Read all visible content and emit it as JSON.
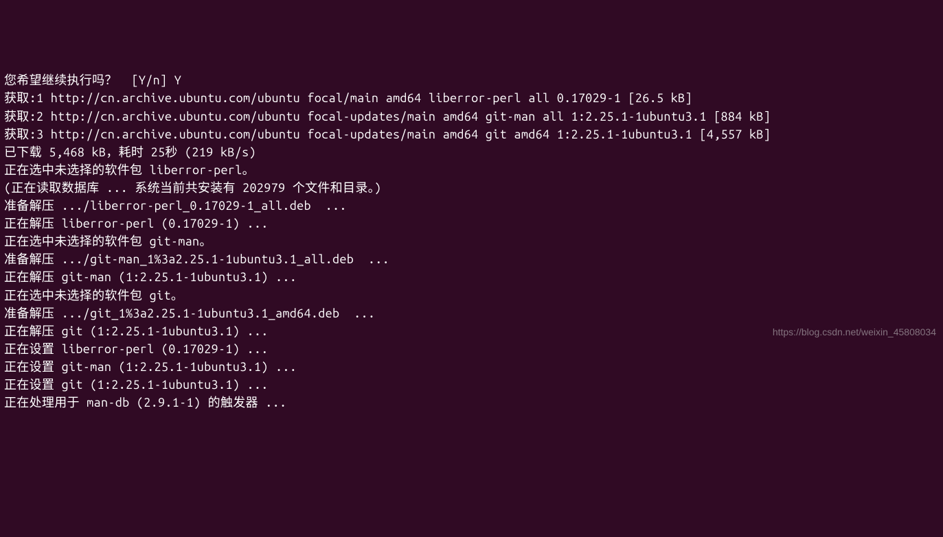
{
  "terminal": {
    "lines": [
      "您希望继续执行吗？  [Y/n] Y",
      "获取:1 http://cn.archive.ubuntu.com/ubuntu focal/main amd64 liberror-perl all 0.17029-1 [26.5 kB]",
      "获取:2 http://cn.archive.ubuntu.com/ubuntu focal-updates/main amd64 git-man all 1:2.25.1-1ubuntu3.1 [884 kB]",
      "获取:3 http://cn.archive.ubuntu.com/ubuntu focal-updates/main amd64 git amd64 1:2.25.1-1ubuntu3.1 [4,557 kB]",
      "已下载 5,468 kB，耗时 25秒 (219 kB/s)",
      "正在选中未选择的软件包 liberror-perl。",
      "(正在读取数据库 ... 系统当前共安装有 202979 个文件和目录。)",
      "准备解压 .../liberror-perl_0.17029-1_all.deb  ...",
      "正在解压 liberror-perl (0.17029-1) ...",
      "正在选中未选择的软件包 git-man。",
      "准备解压 .../git-man_1%3a2.25.1-1ubuntu3.1_all.deb  ...",
      "正在解压 git-man (1:2.25.1-1ubuntu3.1) ...",
      "正在选中未选择的软件包 git。",
      "准备解压 .../git_1%3a2.25.1-1ubuntu3.1_amd64.deb  ...",
      "正在解压 git (1:2.25.1-1ubuntu3.1) ...",
      "正在设置 liberror-perl (0.17029-1) ...",
      "正在设置 git-man (1:2.25.1-1ubuntu3.1) ...",
      "正在设置 git (1:2.25.1-1ubuntu3.1) ...",
      "正在处理用于 man-db (2.9.1-1) 的触发器 ..."
    ]
  },
  "watermark": {
    "text": "https://blog.csdn.net/weixin_45808034"
  }
}
